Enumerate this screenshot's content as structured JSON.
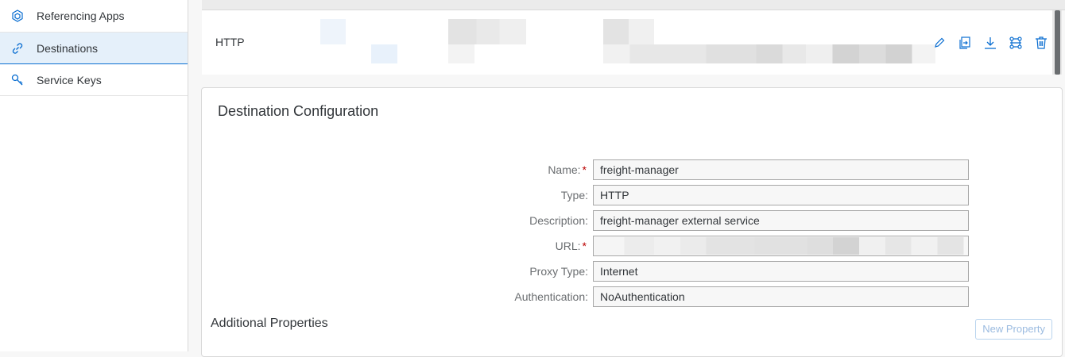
{
  "sidebar": {
    "items": [
      {
        "label": "Referencing Apps",
        "icon": "cube-icon",
        "selected": false
      },
      {
        "label": "Destinations",
        "icon": "link-icon",
        "selected": true
      },
      {
        "label": "Service Keys",
        "icon": "key-icon",
        "selected": false
      }
    ]
  },
  "destination_row": {
    "type": "HTTP",
    "actions": [
      "edit-icon",
      "clone-icon",
      "download-icon",
      "connection-icon",
      "delete-icon"
    ]
  },
  "config": {
    "title": "Destination Configuration",
    "fields": {
      "name": {
        "label": "Name:",
        "value": "freight-manager",
        "required": true
      },
      "type": {
        "label": "Type:",
        "value": "HTTP",
        "required": false
      },
      "description": {
        "label": "Description:",
        "value": "freight-manager external service",
        "required": false
      },
      "url": {
        "label": "URL:",
        "value": "",
        "required": true
      },
      "proxy_type": {
        "label": "Proxy Type:",
        "value": "Internet",
        "required": false
      },
      "authentication": {
        "label": "Authentication:",
        "value": "NoAuthentication",
        "required": false
      }
    },
    "required_mark": "*",
    "additional_properties_title": "Additional Properties",
    "new_property_label": "New Property"
  },
  "colors": {
    "accent": "#0a6ed1",
    "required": "#bb0000",
    "selected_bg": "#e5f0fa"
  }
}
